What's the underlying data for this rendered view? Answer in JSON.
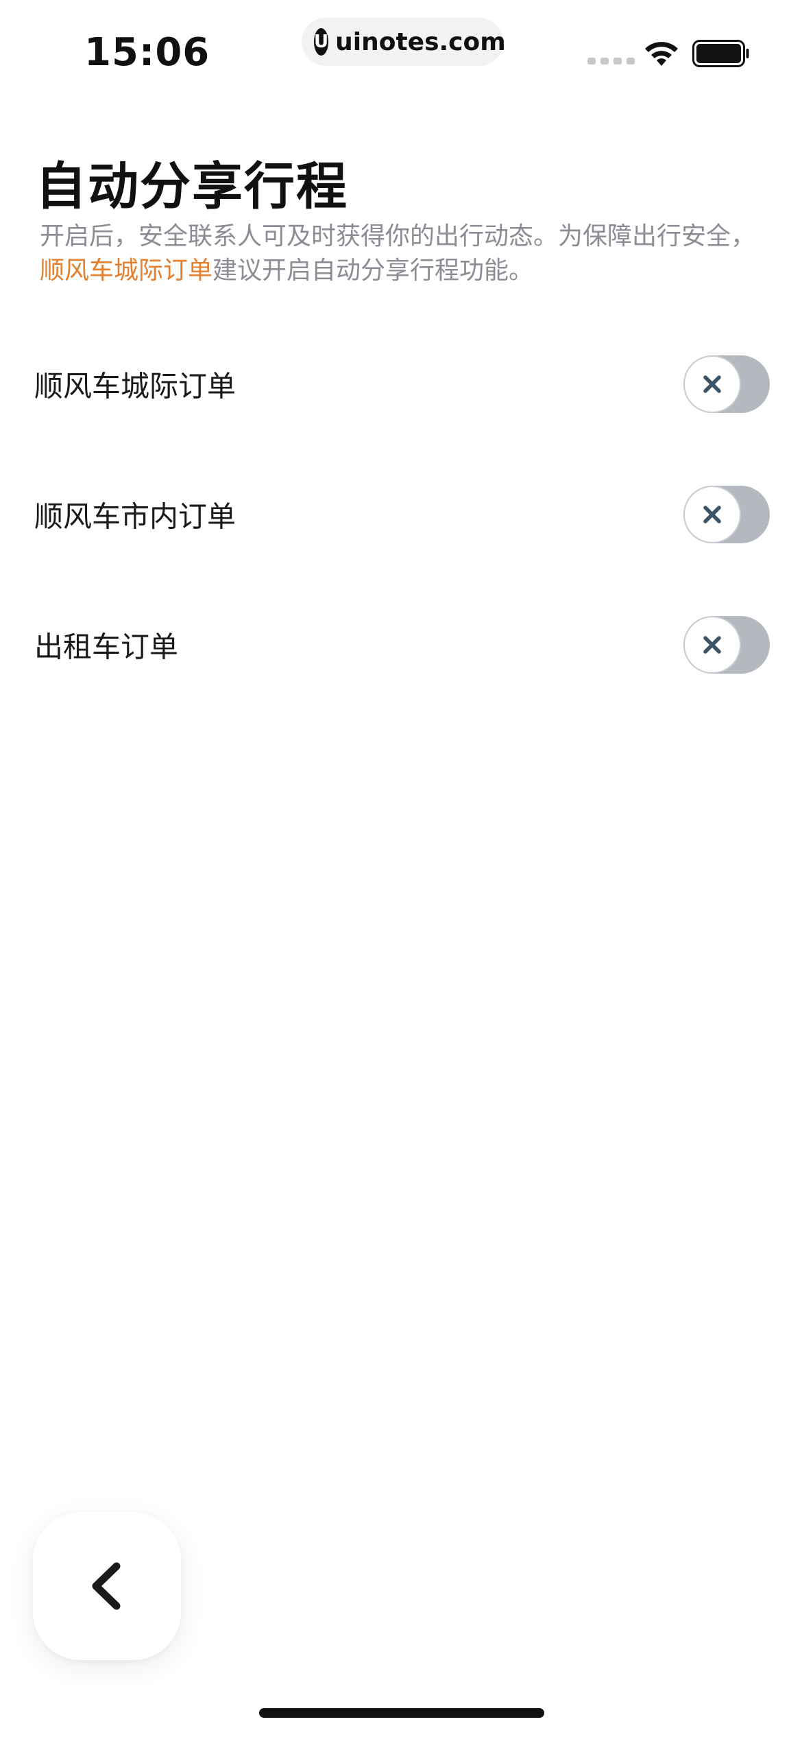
{
  "status_bar": {
    "time": "15:06",
    "url": "uinotes.com",
    "url_logo_glyph": "U",
    "icons": [
      "signal-dots-icon",
      "wifi-icon",
      "battery-icon"
    ]
  },
  "header": {
    "title": "自动分享行程",
    "subtitle_part1": "开启后，安全联系人可及时获得你的出行动态。为保障出行安全，",
    "subtitle_highlight": "顺风车城际订单",
    "subtitle_part2": "建议开启自动分享行程功能。"
  },
  "settings": [
    {
      "label": "顺风车城际订单",
      "enabled": false
    },
    {
      "label": "顺风车市内订单",
      "enabled": false
    },
    {
      "label": "出租车订单",
      "enabled": false
    }
  ],
  "colors": {
    "highlight": "#e47f2e",
    "subtitle": "#8c8c95",
    "toggle_off_track": "#b4b8bf",
    "toggle_icon": "#3d5466"
  },
  "back_button": {
    "icon": "chevron-left-icon"
  }
}
